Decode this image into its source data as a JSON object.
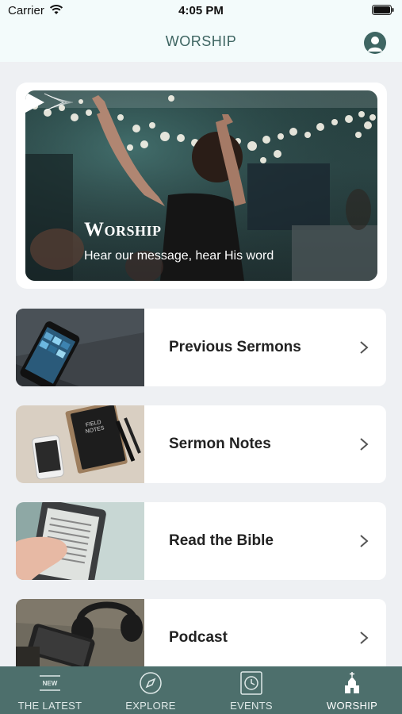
{
  "status_bar": {
    "carrier": "Carrier",
    "time": "4:05 PM",
    "wifi_icon": "wifi-icon",
    "battery_icon": "battery-icon"
  },
  "header": {
    "title": "WORSHIP",
    "profile_icon": "profile-icon"
  },
  "hero": {
    "title": "Worship",
    "subtitle": "Hear our message, hear His word",
    "play_icon": "play-icon"
  },
  "menu": [
    {
      "label": "Previous Sermons",
      "thumb_icon": "phone-on-slate-photo"
    },
    {
      "label": "Sermon Notes",
      "thumb_icon": "notebook-and-phone-photo"
    },
    {
      "label": "Read the Bible",
      "thumb_icon": "ereader-photo"
    },
    {
      "label": "Podcast",
      "thumb_icon": "headphones-and-phone-photo"
    }
  ],
  "tabs": [
    {
      "label": "THE LATEST",
      "icon": "new-badge-icon",
      "active": false
    },
    {
      "label": "EXPLORE",
      "icon": "compass-icon",
      "active": false
    },
    {
      "label": "EVENTS",
      "icon": "clock-icon",
      "active": false
    },
    {
      "label": "WORSHIP",
      "icon": "church-icon",
      "active": true
    }
  ],
  "colors": {
    "accent": "#3f6663",
    "tab_bar": "#4d6f6c",
    "header_bg": "#f3fbfb",
    "page_bg": "#eef0f3"
  }
}
